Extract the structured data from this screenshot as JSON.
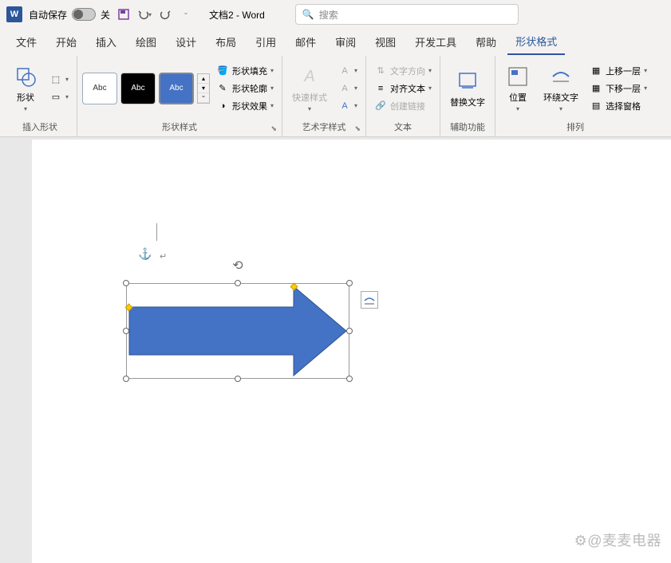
{
  "titlebar": {
    "autosave_label": "自动保存",
    "autosave_off": "关",
    "doc_title": "文档2  -  Word",
    "search_placeholder": "搜索"
  },
  "tabs": {
    "items": [
      "文件",
      "开始",
      "插入",
      "绘图",
      "设计",
      "布局",
      "引用",
      "邮件",
      "审阅",
      "视图",
      "开发工具",
      "帮助",
      "形状格式"
    ],
    "active_index": 12
  },
  "ribbon": {
    "insert_shape": {
      "label": "插入形状",
      "shapes_btn": "形状"
    },
    "shape_styles": {
      "label": "形状样式",
      "preset_text": "Abc",
      "fill": "形状填充",
      "outline": "形状轮廓",
      "effects": "形状效果"
    },
    "wordart": {
      "label": "艺术字样式",
      "quick": "快速样式"
    },
    "text": {
      "label": "文本",
      "direction": "文字方向",
      "align": "对齐文本",
      "link": "创建链接"
    },
    "accessibility": {
      "label": "辅助功能",
      "alt": "替换文字"
    },
    "arrange": {
      "label": "排列",
      "position": "位置",
      "wrap": "环绕文字",
      "forward": "上移一层",
      "backward": "下移一层",
      "pane": "选择窗格"
    }
  },
  "colors": {
    "word_blue": "#2b579a",
    "shape_fill": "#4472c4",
    "shape_border": "#2f528f"
  },
  "watermark": "⚙@麦麦电器"
}
